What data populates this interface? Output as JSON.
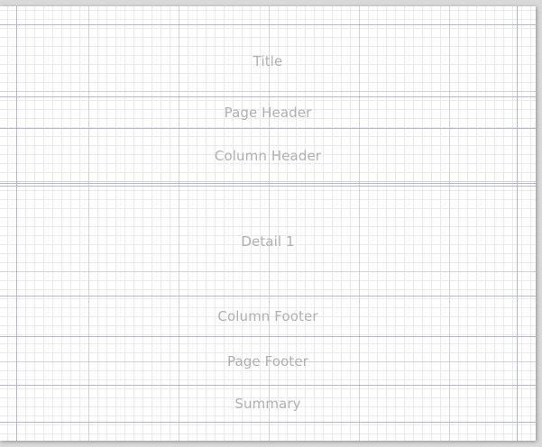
{
  "report_bands": {
    "title": "Title",
    "page_header": "Page Header",
    "column_header": "Column Header",
    "detail_1": "Detail 1",
    "column_footer": "Column Footer",
    "page_footer": "Page Footer",
    "summary": "Summary"
  },
  "colors": {
    "canvas": "#ffffff",
    "band_line": "#b4b4dc",
    "label": "#b0b0b0",
    "grid": "#e8e8e8"
  }
}
